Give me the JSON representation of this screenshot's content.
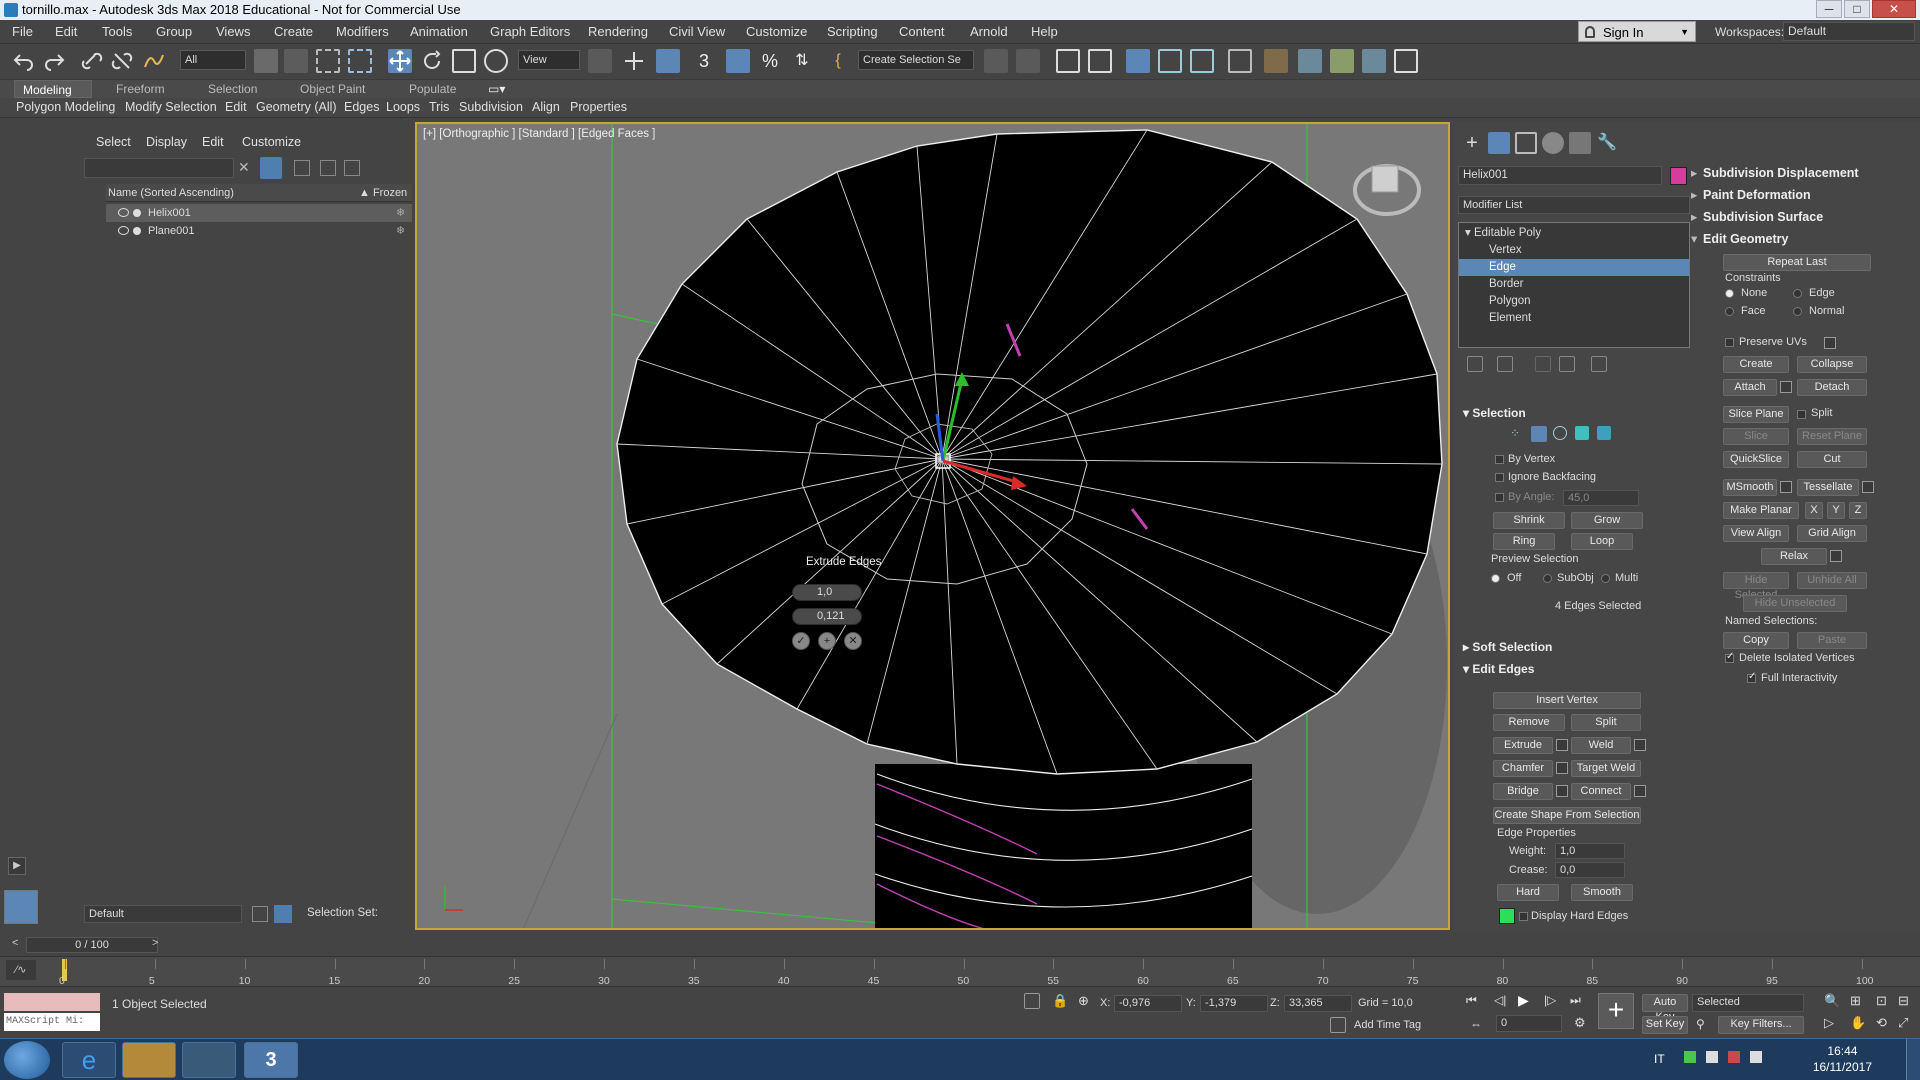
{
  "window": {
    "title": "tornillo.max - Autodesk 3ds Max 2018 Educational - Not for Commercial Use",
    "min": "─",
    "max": "□",
    "close": "✕"
  },
  "menu": [
    "File",
    "Edit",
    "Tools",
    "Group",
    "Views",
    "Create",
    "Modifiers",
    "Animation",
    "Graph Editors",
    "Rendering",
    "Civil View",
    "Customize",
    "Scripting",
    "Content",
    "Arnold",
    "Help"
  ],
  "signin": "Sign In",
  "workspaces": {
    "label": "Workspaces:",
    "value": "Default"
  },
  "toolbar": {
    "filter": "All",
    "refcoord": "View",
    "selset": "Create Selection Se"
  },
  "ribbon": {
    "tabs": [
      "Modeling",
      "Freeform",
      "Selection",
      "Object Paint",
      "Populate"
    ],
    "items": [
      "Polygon Modeling",
      "Modify Selection",
      "Edit",
      "Geometry (All)",
      "Edges",
      "Loops",
      "Tris",
      "Subdivision",
      "Align",
      "Properties"
    ]
  },
  "scene": {
    "tabs": [
      "Select",
      "Display",
      "Edit",
      "Customize"
    ],
    "header": "Name (Sorted Ascending)",
    "frozen": "▲ Frozen",
    "objects": [
      "Helix001",
      "Plane001"
    ],
    "layer": "Default",
    "selset_label": "Selection Set:"
  },
  "viewport": {
    "label": "[+] [Orthographic ] [Standard ] [Edged Faces ]",
    "caddy": {
      "title": "Extrude Edges",
      "height": "1,0",
      "width": "0,121"
    }
  },
  "cmd": {
    "name": "Helix001",
    "color": "#d63b9d",
    "modlist": "Modifier List",
    "stack": [
      "Editable Poly",
      "Vertex",
      "Edge",
      "Border",
      "Polygon",
      "Element"
    ],
    "selection": {
      "title": "Selection",
      "byvertex": "By Vertex",
      "ignore": "Ignore Backfacing",
      "byangle": "By Angle:",
      "angle": "45,0",
      "shrink": "Shrink",
      "grow": "Grow",
      "ring": "Ring",
      "loop": "Loop",
      "preview": "Preview Selection",
      "off": "Off",
      "subobj": "SubObj",
      "multi": "Multi",
      "count": "4 Edges Selected"
    },
    "soft": "Soft Selection",
    "editedges": {
      "title": "Edit Edges",
      "insert": "Insert Vertex",
      "remove": "Remove",
      "split": "Split",
      "extrude": "Extrude",
      "weld": "Weld",
      "chamfer": "Chamfer",
      "tweld": "Target Weld",
      "bridge": "Bridge",
      "connect": "Connect",
      "shape": "Create Shape From Selection",
      "props": "Edge Properties",
      "weight_l": "Weight:",
      "weight": "1,0",
      "crease_l": "Crease:",
      "crease": "0,0",
      "hard": "Hard",
      "smooth": "Smooth",
      "disp": "Display Hard Edges"
    },
    "right": {
      "subdisp": "Subdivision Displacement",
      "paint": "Paint Deformation",
      "subsurf": "Subdivision Surface",
      "editgeo": "Edit Geometry",
      "repeat": "Repeat Last",
      "constraints": "Constraints",
      "none": "None",
      "edge": "Edge",
      "face": "Face",
      "normal": "Normal",
      "preserve": "Preserve UVs",
      "create": "Create",
      "collapse": "Collapse",
      "attach": "Attach",
      "detach": "Detach",
      "sliceplane": "Slice Plane",
      "split": "Split",
      "slice": "Slice",
      "resetplane": "Reset Plane",
      "quickslice": "QuickSlice",
      "cut": "Cut",
      "msmooth": "MSmooth",
      "tess": "Tessellate",
      "planar": "Make Planar",
      "x": "X",
      "y": "Y",
      "z": "Z",
      "valign": "View Align",
      "galign": "Grid Align",
      "relax": "Relax",
      "hidesel": "Hide Selected",
      "unhide": "Unhide All",
      "hideuns": "Hide Unselected",
      "named": "Named Selections:",
      "copy": "Copy",
      "paste": "Paste",
      "deliso": "Delete Isolated Vertices",
      "fullint": "Full Interactivity"
    }
  },
  "timeline": {
    "frame": "0 / 100",
    "ticks": [
      "0",
      "5",
      "10",
      "15",
      "20",
      "25",
      "30",
      "35",
      "40",
      "45",
      "50",
      "55",
      "60",
      "65",
      "70",
      "75",
      "80",
      "85",
      "90",
      "95",
      "100"
    ]
  },
  "status": {
    "maxscript": "MAXScript Mi:",
    "selected": "1 Object Selected",
    "x_l": "X:",
    "x": "-0,976",
    "y_l": "Y:",
    "y": "-1,379",
    "z_l": "Z:",
    "z": "33,365",
    "grid": "Grid = 10,0",
    "addtime": "Add Time Tag",
    "autokey": "Auto Key",
    "setkey": "Set Key",
    "selmode": "Selected",
    "keyfilters": "Key Filters...",
    "frame": "0"
  },
  "taskbar": {
    "lang": "IT",
    "time": "16:44",
    "date": "16/11/2017"
  }
}
